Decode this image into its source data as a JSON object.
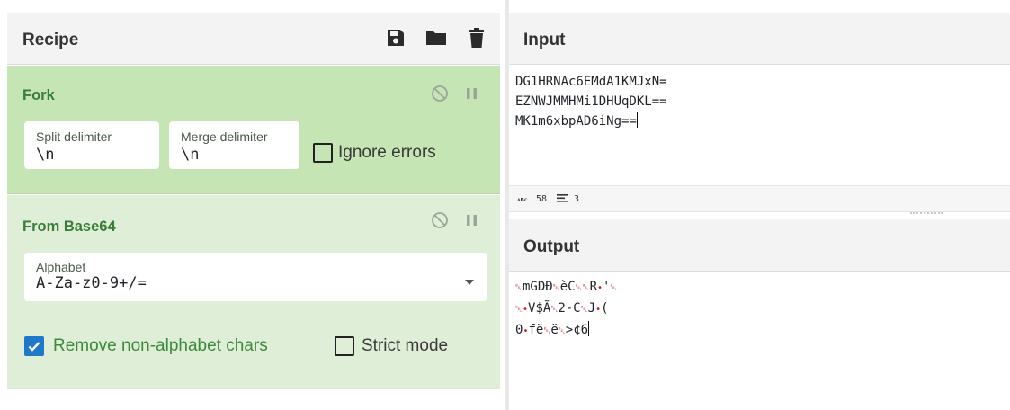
{
  "recipe": {
    "title": "Recipe",
    "actions": [
      "save-icon",
      "folder-icon",
      "trash-icon"
    ],
    "operations": [
      {
        "name": "Fork",
        "controls": [
          "disable-icon",
          "pause-icon"
        ],
        "fields": [
          {
            "label": "Split delimiter",
            "value": "\\n"
          },
          {
            "label": "Merge delimiter",
            "value": "\\n"
          }
        ],
        "checkbox": {
          "label": "Ignore errors",
          "checked": false
        }
      },
      {
        "name": "From Base64",
        "controls": [
          "disable-icon",
          "pause-icon"
        ],
        "fields": [
          {
            "label": "Alphabet",
            "value": "A-Za-z0-9+/="
          }
        ],
        "checkboxes": [
          {
            "label": "Remove non-alphabet chars",
            "checked": true
          },
          {
            "label": "Strict mode",
            "checked": false
          }
        ]
      }
    ]
  },
  "input": {
    "title": "Input",
    "lines": [
      "DG1HRNAc6EMdA1KMJxN=",
      "EZNWJMMHMi1DHUqDKL==",
      "MK1m6xbpAD6iNg=="
    ],
    "status": {
      "length": "58",
      "lines": "3"
    }
  },
  "output": {
    "title": "Output",
    "line1_parts": [
      "mGDÐ",
      "èC",
      "R",
      "'"
    ],
    "line2_parts": [
      "V$Ã",
      "2-C",
      "J",
      "("
    ],
    "line3_parts": [
      "0",
      "fë",
      "ë",
      ">¢6"
    ]
  },
  "colors": {
    "fork_bg": "#c6e5b5",
    "base64_bg": "#dfeed6",
    "op_title": "#3a7d3a",
    "checkbox_checked": "#1f78c8",
    "invalid_char": "#d11f1f"
  }
}
